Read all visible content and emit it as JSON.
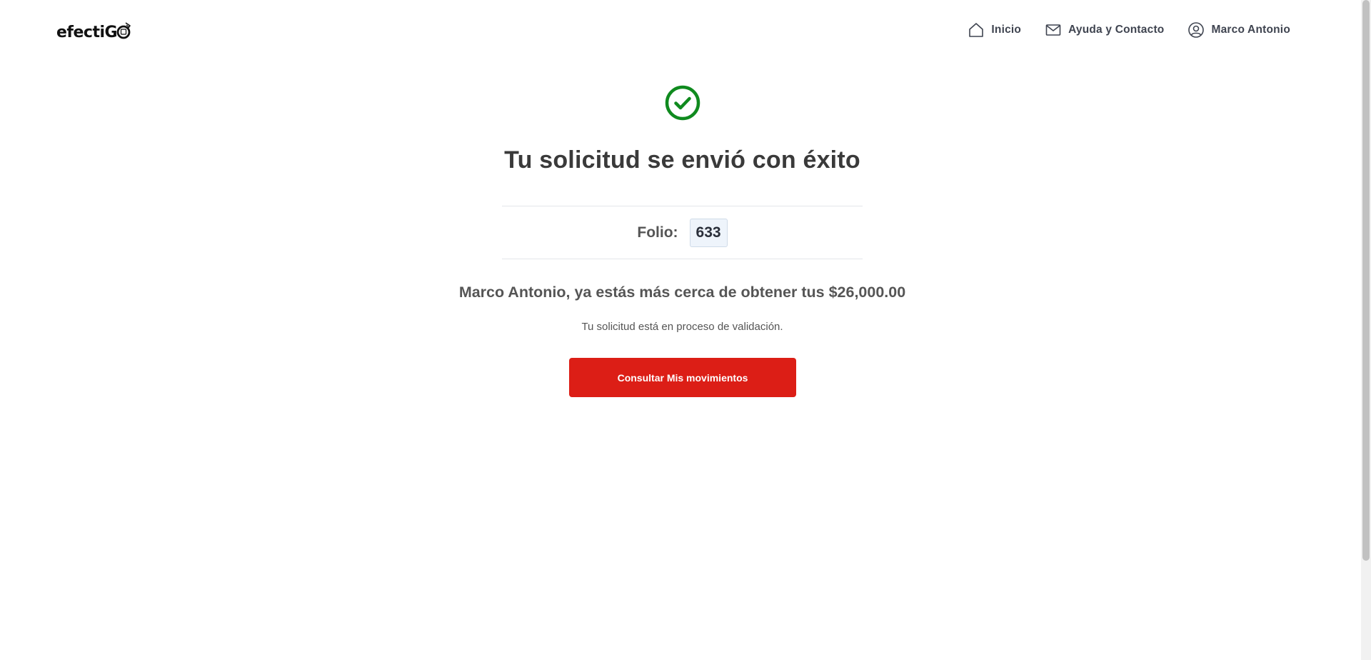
{
  "header": {
    "logo_text": "efectiG",
    "nav": [
      {
        "label": "Inicio",
        "icon": "home-icon"
      },
      {
        "label": "Ayuda y Contacto",
        "icon": "mail-icon"
      },
      {
        "label": "Marco Antonio",
        "icon": "user-circle-icon"
      }
    ]
  },
  "main": {
    "status_icon": "check-circle-icon",
    "title": "Tu solicitud se envió con éxito",
    "folio_label": "Folio:",
    "folio_value": "633",
    "message": "Marco Antonio, ya estás más cerca de obtener tus $26,000.00",
    "sub_message": "Tu solicitud está en proceso de validación.",
    "button_label": "Consultar Mis movimientos"
  },
  "colors": {
    "accent": "#dc1e16",
    "success": "#0f8a1e",
    "text": "#3a3a3a"
  }
}
